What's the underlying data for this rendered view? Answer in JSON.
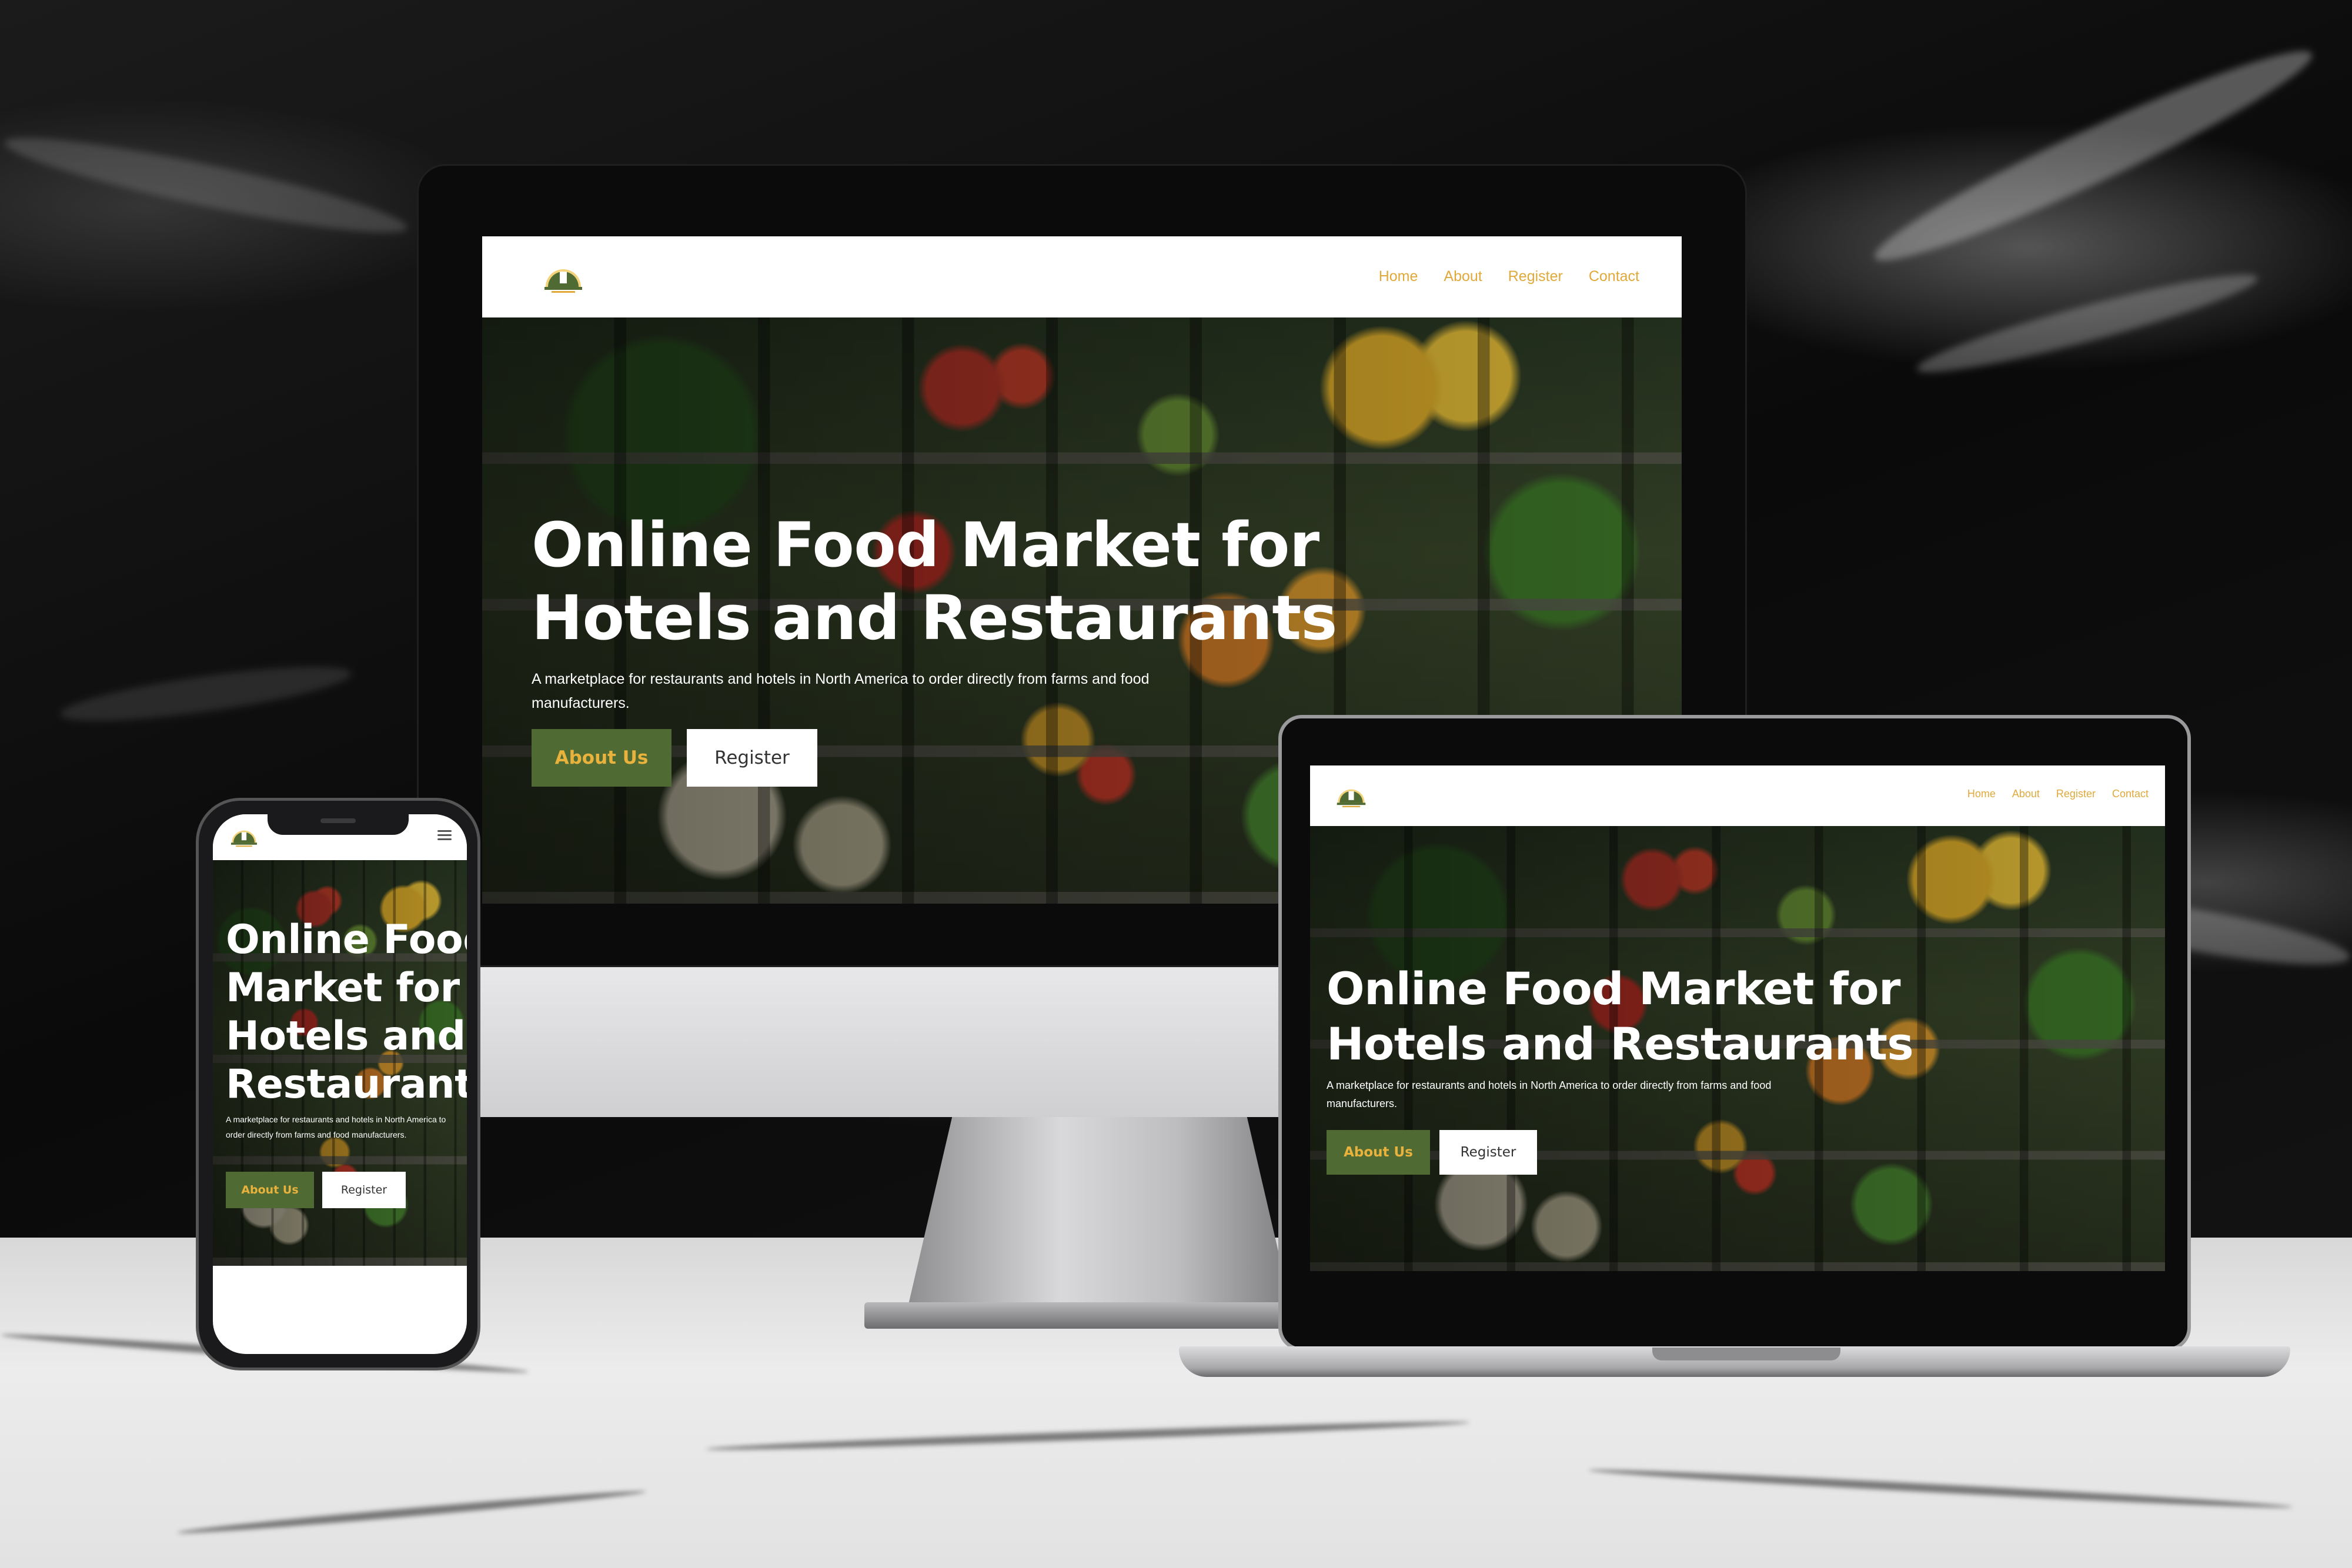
{
  "site": {
    "logo_icon": "food-market-logo",
    "nav": [
      "Home",
      "About",
      "Register",
      "Contact"
    ],
    "hero_title": "Online Food Market for Hotels and Restaurants",
    "hero_title_line1": "Online Food Market for",
    "hero_title_line2": "Hotels and Restaurants",
    "hero_title_phone": [
      "Online Food",
      "Market for",
      "Hotels and",
      "Restaurants"
    ],
    "hero_text": "A marketplace for restaurants and hotels in North America to order directly from farms and food manufacturers.",
    "about_button": "About Us",
    "register_button": "Register"
  },
  "colors": {
    "accent_gold": "#e0a93a",
    "button_green": "#4f6b33",
    "white": "#ffffff"
  },
  "icons": {
    "menu": "hamburger-menu-icon"
  }
}
